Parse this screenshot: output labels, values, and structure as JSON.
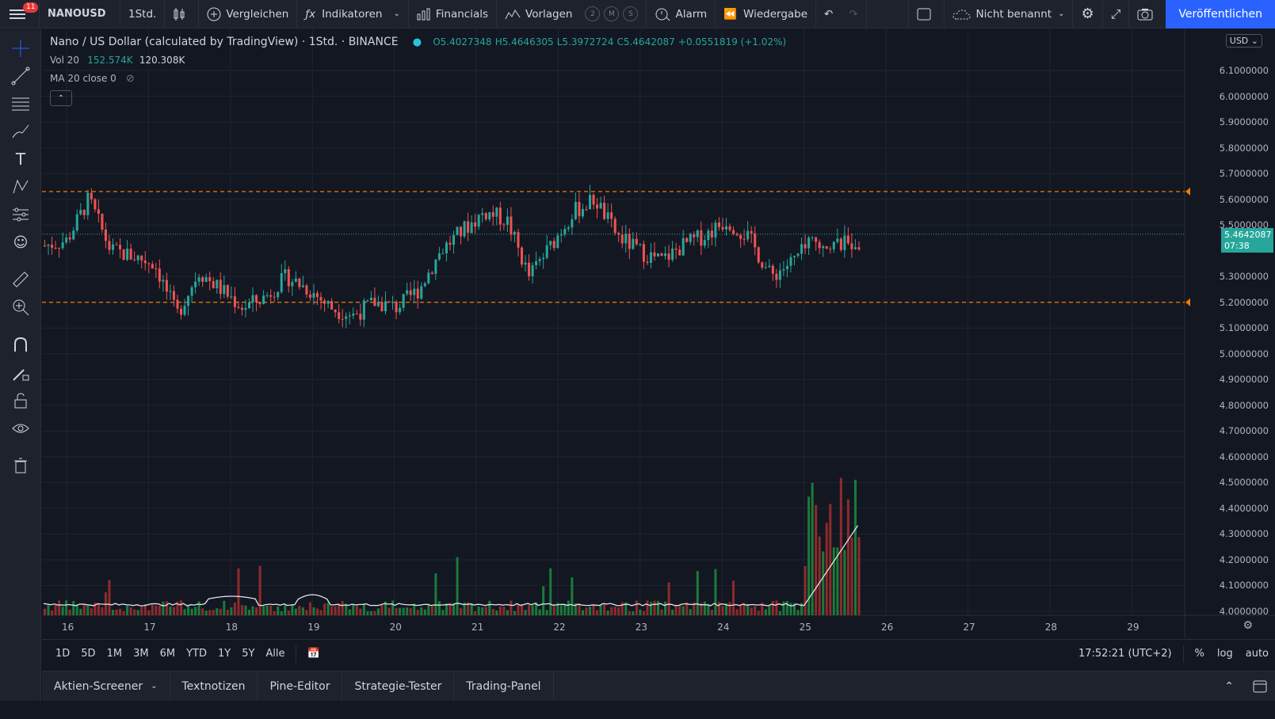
{
  "topbar": {
    "notif_count": "11",
    "symbol": "NANOUSD",
    "interval": "1Std.",
    "compare": "Vergleichen",
    "indicators": "Indikatoren",
    "financials": "Financials",
    "templates": "Vorlagen",
    "badges": [
      "2",
      "M",
      "S"
    ],
    "alert": "Alarm",
    "replay": "Wiedergabe",
    "layout_name": "Nicht benannt",
    "publish": "Veröffentlichen"
  },
  "legend": {
    "title": "Nano / US Dollar (calculated by TradingView) · 1Std. · BINANCE",
    "o": "O5.4027348",
    "h": "H5.4646305",
    "l": "L5.3972724",
    "c": "C5.4642087",
    "change": "+0.0551819 (+1.02%)",
    "vol_label": "Vol 20",
    "vol_value": "152.574K",
    "vol_ma": "120.308K",
    "ma_label": "MA 20 close 0"
  },
  "price_axis": {
    "currency": "USD",
    "ticks": [
      "6.1000000",
      "6.0000000",
      "5.9000000",
      "5.8000000",
      "5.7000000",
      "5.6000000",
      "5.5000000",
      "5.3000000",
      "5.2000000",
      "5.1000000",
      "5.0000000",
      "4.9000000",
      "4.8000000",
      "4.7000000",
      "4.6000000",
      "4.5000000",
      "4.4000000",
      "4.3000000",
      "4.2000000",
      "4.1000000",
      "4.0000000"
    ],
    "current_price": "5.4642087",
    "countdown": "07:38"
  },
  "time_axis": {
    "labels": [
      "16",
      "17",
      "18",
      "19",
      "20",
      "21",
      "22",
      "23",
      "24",
      "25",
      "26",
      "27",
      "28",
      "29"
    ]
  },
  "rangebar": {
    "ranges": [
      "1D",
      "5D",
      "1M",
      "3M",
      "6M",
      "YTD",
      "1Y",
      "5Y",
      "Alle"
    ],
    "clock": "17:52:21 (UTC+2)",
    "percent": "%",
    "log": "log",
    "auto": "auto"
  },
  "panels": {
    "tabs": [
      "Aktien-Screener",
      "Textnotizen",
      "Pine-Editor",
      "Strategie-Tester",
      "Trading-Panel"
    ]
  },
  "colors": {
    "up": "#26a69a",
    "down": "#ef5350",
    "level_line": "#f57c00",
    "accent": "#2962ff"
  },
  "chart_data": {
    "type": "candlestick",
    "title": "Nano / US Dollar (calculated by TradingView) · 1Std. · BINANCE",
    "ylim": [
      4.0,
      6.1
    ],
    "horizontal_levels": [
      5.63,
      5.2
    ],
    "x_labels": [
      "16",
      "17",
      "18",
      "19",
      "20",
      "21",
      "22",
      "23",
      "24",
      "25",
      "26",
      "27",
      "28",
      "29"
    ],
    "last_price": 5.4642087,
    "volume_series_name": "Vol 20",
    "volume_ma_name": "MA 20 close 0"
  }
}
